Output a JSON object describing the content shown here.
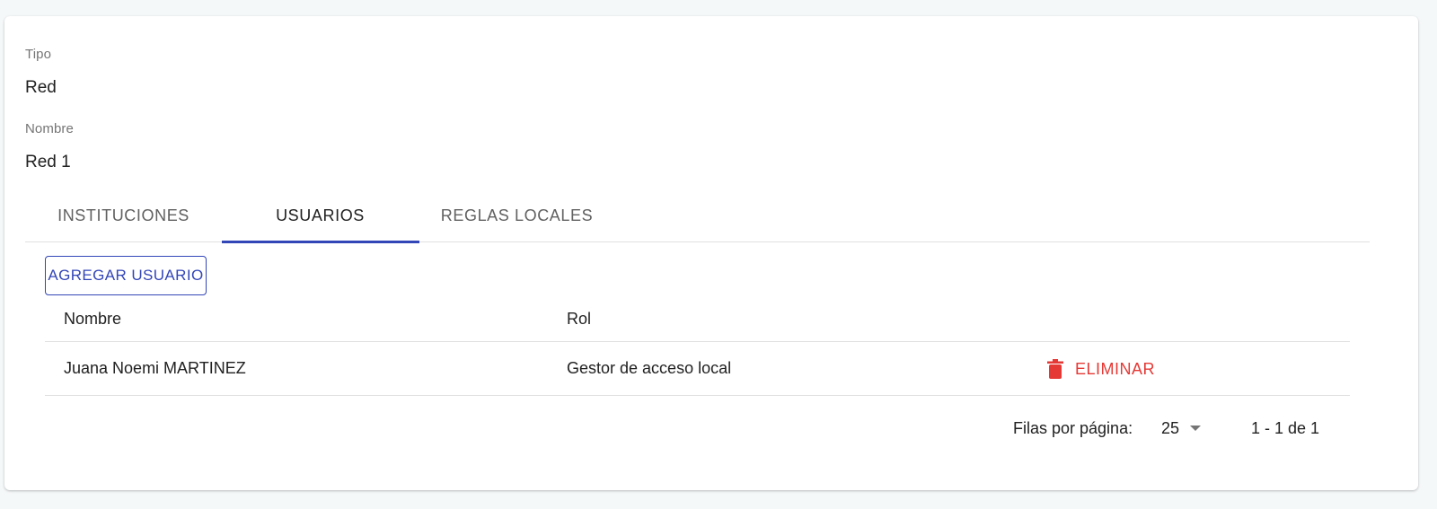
{
  "details": {
    "type_label": "Tipo",
    "type_value": "Red",
    "name_label": "Nombre",
    "name_value": "Red 1"
  },
  "tabs": [
    {
      "label": "INSTITUCIONES",
      "active": false
    },
    {
      "label": "USUARIOS",
      "active": true
    },
    {
      "label": "REGLAS LOCALES",
      "active": false
    }
  ],
  "toolbar": {
    "add_user_label": "AGREGAR USUARIO"
  },
  "table": {
    "headers": [
      "Nombre",
      "Rol"
    ],
    "rows": [
      {
        "name": "Juana Noemi MARTINEZ",
        "role": "Gestor de acceso local",
        "action_label": "ELIMINAR",
        "action_icon": "trash-icon"
      }
    ]
  },
  "pagination": {
    "rows_per_page_label": "Filas por página:",
    "rows_per_page_value": "25",
    "range_label": "1 - 1 de 1"
  },
  "colors": {
    "accent": "#3346b8",
    "danger": "#e53935",
    "background": "#f5f8f9"
  }
}
